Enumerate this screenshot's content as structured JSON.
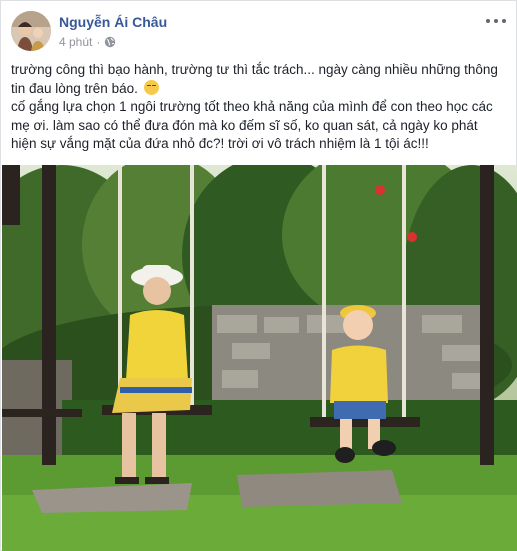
{
  "post": {
    "author": "Nguyễn Ái Châu",
    "time": "4 phút",
    "privacy_icon": "globe-icon",
    "more_icon": "more-dots-icon",
    "paragraphs": [
      "trường công thì bạo hành, trường tư thì tắc trách... ngày càng nhiều những thông tin đau lòng trên báo.",
      "cố gắng lựa chọn 1 ngôi trường tốt theo khả năng của mình để con theo học các mẹ ơi. làm sao có thể đưa đón mà ko đếm sĩ số, ko quan sát, cả ngày ko phát hiện sự vắng mặt của đứa nhỏ đc?! trời ơi vô trách nhiệm là 1 tội ác!!!"
    ],
    "emoji": "pensive-face-icon"
  },
  "colors": {
    "name": "#385898",
    "meta": "#90949c",
    "text": "#1d2129",
    "border": "#dddfe2"
  }
}
